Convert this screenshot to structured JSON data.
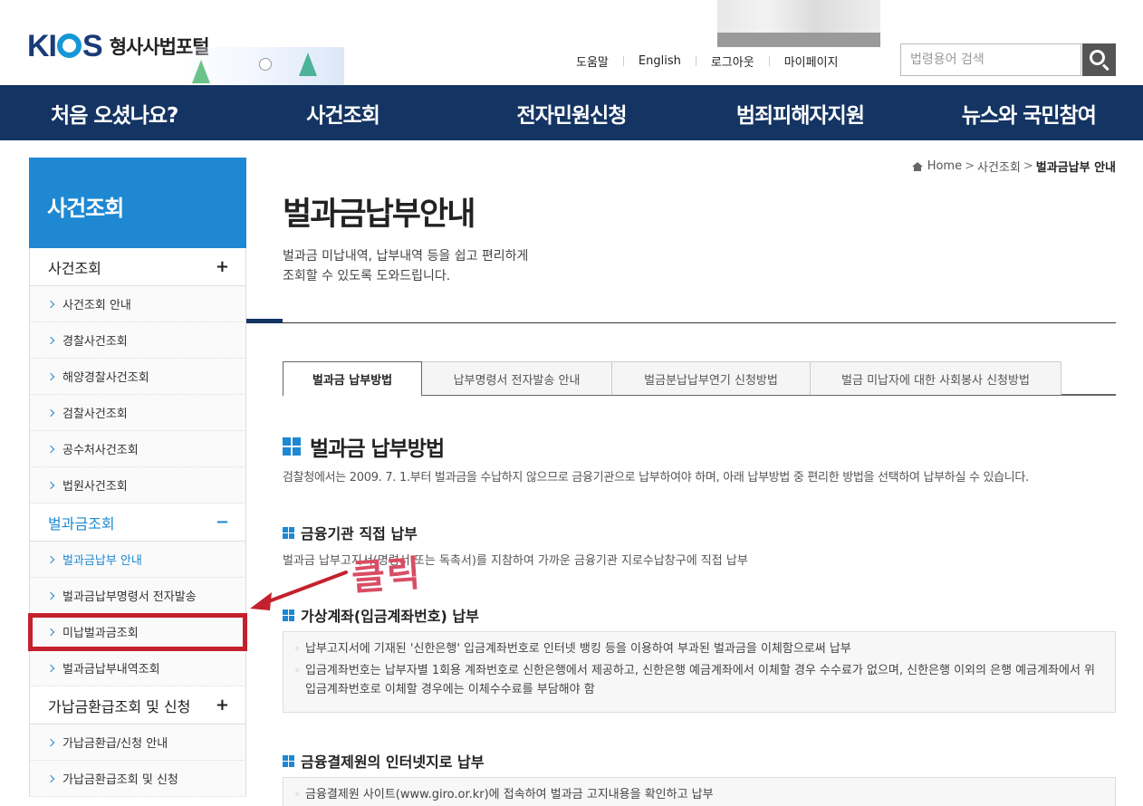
{
  "header": {
    "logo_mark": "KICS",
    "logo_text": "형사사법포털",
    "util_links": [
      "도움말",
      "English",
      "로그아웃",
      "마이페이지"
    ],
    "search_placeholder": "법령용어 검색"
  },
  "gnb": [
    "처음 오셨나요?",
    "사건조회",
    "전자민원신청",
    "범죄피해자지원",
    "뉴스와 국민참여"
  ],
  "sidebar": {
    "title": "사건조회",
    "groups": [
      {
        "label": "사건조회",
        "sign": "+",
        "items": [
          "사건조회 안내",
          "경찰사건조회",
          "해양경찰사건조회",
          "검찰사건조회",
          "공수처사건조회",
          "법원사건조회"
        ]
      },
      {
        "label": "벌과금조회",
        "sign": "−",
        "items": [
          "벌과금납부 안내",
          "벌과금납부명령서 전자발송",
          "미납벌과금조회",
          "벌과금납부내역조회"
        ]
      },
      {
        "label": "가납금환급조회 및 신청",
        "sign": "+",
        "items": [
          "가납금환급/신청 안내",
          "가납금환급조회 및 신청"
        ]
      }
    ]
  },
  "annotation": {
    "text": "클릭"
  },
  "breadcrumb": {
    "home": "Home",
    "level1": "사건조회",
    "current": "벌과금납부 안내"
  },
  "page": {
    "title": "벌과금납부안내",
    "desc_line1": "벌과금 미납내역, 납부내역 등을 쉽고 편리하게",
    "desc_line2": "조회할 수 있도록 도와드립니다."
  },
  "tabs": [
    "벌과금 납부방법",
    "납부명령서 전자발송 안내",
    "벌금분납납부연기 신청방법",
    "벌금 미납자에 대한 사회봉사 신청방법"
  ],
  "content": {
    "h2": "벌과금 납부방법",
    "intro": "검찰청에서는 2009. 7. 1.부터 벌과금을 수납하지 않으므로 금융기관으로 납부하여야 하며, 아래 납부방법 중 편리한 방법을 선택하여 납부하실 수 있습니다.",
    "section1": {
      "title": "금융기관 직접 납부",
      "text": "벌과금 납부고지서(명령서 또는 독촉서)를 지참하여 가까운 금융기관 지로수납창구에 직접 납부"
    },
    "section2": {
      "title": "가상계좌(입금계좌번호) 납부",
      "items": [
        "납부고지서에 기재된 '신한은행' 입금계좌번호로 인터넷 뱅킹 등을 이용하여 부과된 벌과금을 이체함으로써 납부",
        "입금계좌번호는 납부자별 1회용 계좌번호로 신한은행에서 제공하고, 신한은행 예금계좌에서 이체할 경우 수수료가 없으며, 신한은행 이외의 은행 예금계좌에서 위 입금계좌번호로 이체할 경우에는 이체수수료를 부담해야 함"
      ]
    },
    "section3": {
      "title": "금융결제원의 인터넷지로 납부",
      "items": [
        "금융결제원 사이트(www.giro.or.kr)에 접속하여 벌과금 고지내용을 확인하고 납부"
      ]
    }
  }
}
